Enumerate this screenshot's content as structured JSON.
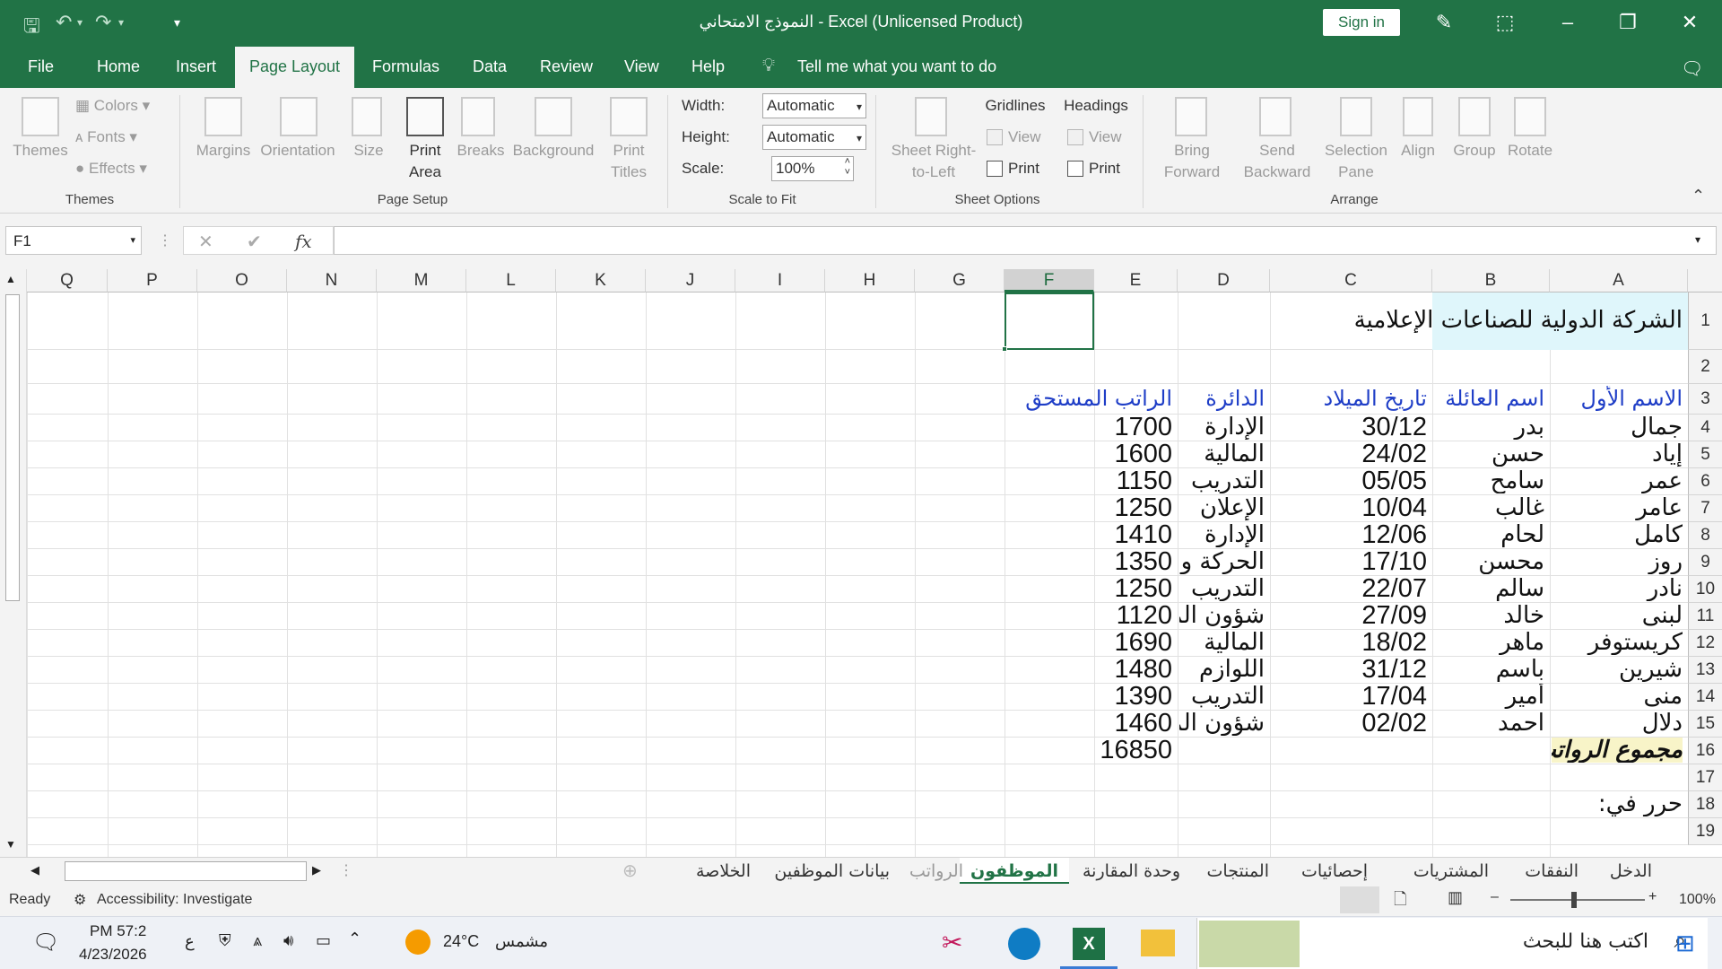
{
  "titlebar": {
    "title": "النموذج الامتحاني  -  Excel (Unlicensed Product)",
    "signin": "Sign in"
  },
  "menu": {
    "file": "File",
    "home": "Home",
    "insert": "Insert",
    "page_layout": "Page Layout",
    "formulas": "Formulas",
    "data": "Data",
    "review": "Review",
    "view": "View",
    "help": "Help",
    "tell_me": "Tell me what you want to do"
  },
  "ribbon": {
    "themes": {
      "themes": "Themes",
      "colors": "Colors",
      "fonts": "Fonts",
      "effects": "Effects",
      "group": "Themes"
    },
    "page_setup": {
      "margins": "Margins",
      "orientation": "Orientation",
      "size": "Size",
      "print_area_1": "Print",
      "print_area_2": "Area",
      "breaks": "Breaks",
      "background": "Background",
      "print_titles_1": "Print",
      "print_titles_2": "Titles",
      "group": "Page Setup"
    },
    "scale": {
      "width_label": "Width:",
      "width_value": "Automatic",
      "height_label": "Height:",
      "height_value": "Automatic",
      "scale_label": "Scale:",
      "scale_value": "100%",
      "group": "Scale to Fit"
    },
    "sheet_options": {
      "sheet_rtl_1": "Sheet Right-",
      "sheet_rtl_2": "to-Left",
      "gridlines": "Gridlines",
      "headings": "Headings",
      "view": "View",
      "print": "Print",
      "group": "Sheet Options"
    },
    "arrange": {
      "bring_1": "Bring",
      "bring_2": "Forward",
      "send_1": "Send",
      "send_2": "Backward",
      "sel_1": "Selection",
      "sel_2": "Pane",
      "align": "Align",
      "group_btn": "Group",
      "rotate": "Rotate",
      "group": "Arrange"
    }
  },
  "formula_bar": {
    "name_box": "F1",
    "fx": "fx",
    "formula": ""
  },
  "columns": [
    "A",
    "B",
    "C",
    "D",
    "E",
    "F",
    "G",
    "H",
    "I",
    "J",
    "K",
    "L",
    "M",
    "N",
    "O",
    "P",
    "Q"
  ],
  "rows": [
    "1",
    "2",
    "3",
    "4",
    "5",
    "6",
    "7",
    "8",
    "9",
    "10",
    "11",
    "12",
    "13",
    "14",
    "15",
    "16",
    "17",
    "18",
    "19"
  ],
  "sheet": {
    "company": "الشركة الدولية للصناعات الإعلامية",
    "headers": {
      "first": "الاسم الأول",
      "last": "اسم العائلة",
      "dob": "تاريخ الميلاد",
      "dept": "الدائرة",
      "salary": "الراتب المستحق"
    },
    "records": [
      {
        "first": "جمال",
        "last": "بدر",
        "dob": "30/12",
        "dept": "الإدارة",
        "salary": "1700"
      },
      {
        "first": "إياد",
        "last": "حسن",
        "dob": "24/02",
        "dept": "المالية",
        "salary": "1600"
      },
      {
        "first": "عمر",
        "last": "سامح",
        "dob": "05/05",
        "dept": "التدريب",
        "salary": "1150"
      },
      {
        "first": "عامر",
        "last": "غالب",
        "dob": "10/04",
        "dept": "الإعلان",
        "salary": "1250"
      },
      {
        "first": "كامل",
        "last": "لحام",
        "dob": "12/06",
        "dept": "الإدارة",
        "salary": "1410"
      },
      {
        "first": "روز",
        "last": "محسن",
        "dob": "17/10",
        "dept": "الحركة والنقل",
        "salary": "1350"
      },
      {
        "first": "نادر",
        "last": "سالم",
        "dob": "22/07",
        "dept": "التدريب",
        "salary": "1250"
      },
      {
        "first": "لبنى",
        "last": "خالد",
        "dob": "27/09",
        "dept": "شؤون الموظفين",
        "salary": "1120"
      },
      {
        "first": "كريستوفر",
        "last": "ماهر",
        "dob": "18/02",
        "dept": "المالية",
        "salary": "1690"
      },
      {
        "first": "شيرين",
        "last": "باسم",
        "dob": "31/12",
        "dept": "اللوازم",
        "salary": "1480"
      },
      {
        "first": "منى",
        "last": "أمير",
        "dob": "17/04",
        "dept": "التدريب",
        "salary": "1390"
      },
      {
        "first": "دلال",
        "last": "احمد",
        "dob": "02/02",
        "dept": "شؤون الموظفين",
        "salary": "1460"
      }
    ],
    "total_label": "مجموع الرواتب",
    "total_value": "16850",
    "edited_label": "حرر في:"
  },
  "sheet_tabs": [
    "الدخل",
    "النفقات",
    "المشتريات",
    "إحصائيات",
    "المنتجات",
    "وحدة المقارنة",
    "الموظفون",
    "الرواتب",
    "بيانات الموظفين",
    "الخلاصة"
  ],
  "status": {
    "ready": "Ready",
    "accessibility": "Accessibility: Investigate",
    "zoom": "100%"
  },
  "taskbar": {
    "search": "اكتب هنا للبحث",
    "weather": "24°C",
    "weather_desc": "مشمس",
    "lang": "ع",
    "time": "PM 57:2",
    "date": "4/23/2026"
  }
}
